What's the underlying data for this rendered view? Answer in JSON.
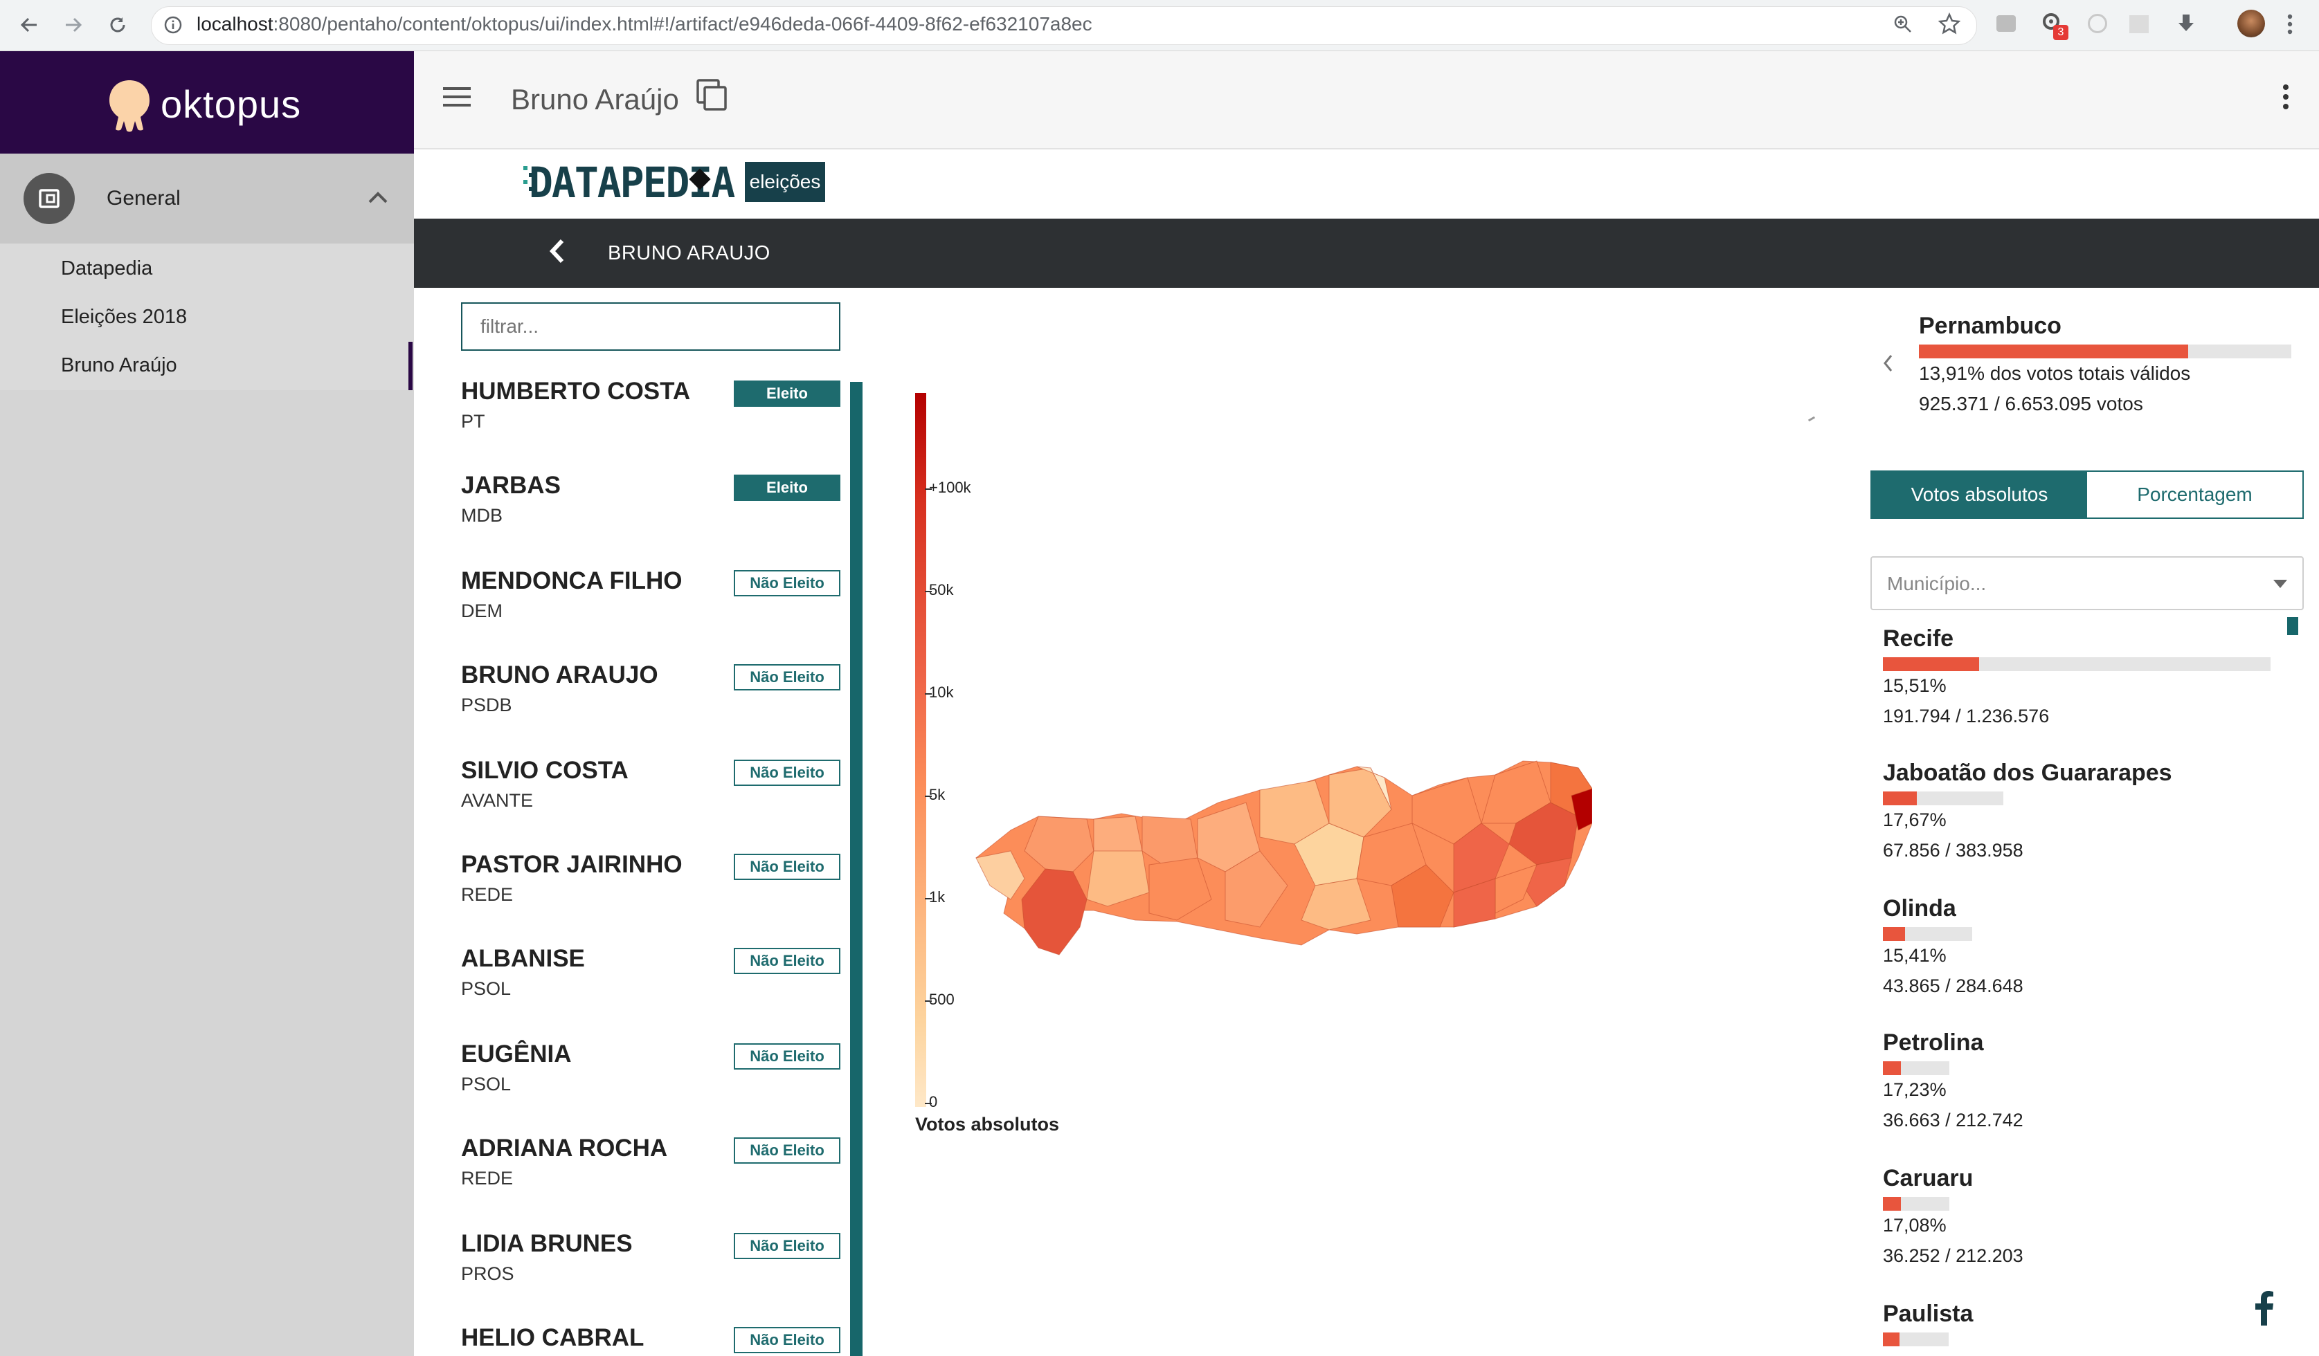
{
  "browser": {
    "url_host": "localhost",
    "url_rest": ":8080/pentaho/content/oktopus/ui/index.html#!/artifact/e946deda-066f-4409-8f62-ef632107a8ec",
    "badge_count": "3"
  },
  "sidebar": {
    "brand": "oktopus",
    "section": "General",
    "items": [
      "Datapedia",
      "Eleições 2018",
      "Bruno Araújo"
    ]
  },
  "header": {
    "title": "Bruno Araújo"
  },
  "logo": {
    "word": "DATAPEDIA",
    "tag": "eleições"
  },
  "darkbar": {
    "title": "BRUNO ARAUJO"
  },
  "filter": {
    "placeholder": "filtrar...",
    "value": ""
  },
  "candidates": [
    {
      "name": "HUMBERTO COSTA",
      "party": "PT",
      "status": "Eleito"
    },
    {
      "name": "JARBAS",
      "party": "MDB",
      "status": "Eleito"
    },
    {
      "name": "MENDONCA FILHO",
      "party": "DEM",
      "status": "Não Eleito"
    },
    {
      "name": "BRUNO ARAUJO",
      "party": "PSDB",
      "status": "Não Eleito"
    },
    {
      "name": "SILVIO COSTA",
      "party": "AVANTE",
      "status": "Não Eleito"
    },
    {
      "name": "PASTOR JAIRINHO",
      "party": "REDE",
      "status": "Não Eleito"
    },
    {
      "name": "ALBANISE",
      "party": "PSOL",
      "status": "Não Eleito"
    },
    {
      "name": "EUGÊNIA",
      "party": "PSOL",
      "status": "Não Eleito"
    },
    {
      "name": "ADRIANA ROCHA",
      "party": "REDE",
      "status": "Não Eleito"
    },
    {
      "name": "LIDIA BRUNES",
      "party": "PROS",
      "status": "Não Eleito"
    },
    {
      "name": "HELIO CABRAL",
      "party": "",
      "status": "Não Eleito"
    }
  ],
  "legend": {
    "title": "Votos absolutos",
    "ticks": [
      "+100k",
      "50k",
      "10k",
      "5k",
      "1k",
      "500",
      "0"
    ]
  },
  "state": {
    "name": "Pernambuco",
    "pct_text": "13,91% dos votos totais válidos",
    "votes_text": "925.371 / 6.653.095 votos",
    "share": 0.1391
  },
  "tabs": [
    "Votos absolutos",
    "Porcentagem"
  ],
  "municipio": {
    "placeholder": "Município..."
  },
  "municipalities": [
    {
      "name": "Recife",
      "pct": "15,51%",
      "votes": "191.794 / 1.236.576",
      "share": 0.1551,
      "total_rel": 1.0
    },
    {
      "name": "Jaboatão dos Guararapes",
      "pct": "17,67%",
      "votes": "67.856 / 383.958",
      "share": 0.1767,
      "total_rel": 0.31
    },
    {
      "name": "Olinda",
      "pct": "15,41%",
      "votes": "43.865 / 284.648",
      "share": 0.1541,
      "total_rel": 0.23
    },
    {
      "name": "Petrolina",
      "pct": "17,23%",
      "votes": "36.663 / 212.742",
      "share": 0.1723,
      "total_rel": 0.172
    },
    {
      "name": "Caruaru",
      "pct": "17,08%",
      "votes": "36.252 / 212.203",
      "share": 0.1708,
      "total_rel": 0.172
    },
    {
      "name": "Paulista",
      "pct": "",
      "votes": "",
      "share": 0.16,
      "total_rel": 0.17
    }
  ],
  "colors": {
    "brand": "#2a0845",
    "teal": "#1e6b6e",
    "accent": "#e8553d",
    "dark": "#2d3033"
  }
}
